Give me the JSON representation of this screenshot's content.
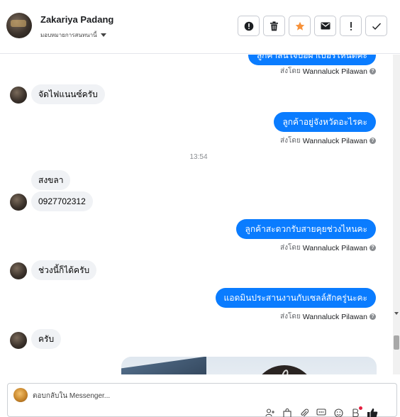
{
  "header": {
    "contact_name": "Zakariya Padang",
    "subtitle": "มอบหมายการสนทนานี้"
  },
  "actions": [
    {
      "name": "spam",
      "icon": "alert-circle-icon"
    },
    {
      "name": "delete",
      "icon": "trash-icon"
    },
    {
      "name": "star",
      "icon": "star-icon",
      "color": "#f7923a"
    },
    {
      "name": "mail",
      "icon": "envelope-icon"
    },
    {
      "name": "important",
      "icon": "exclamation-icon"
    },
    {
      "name": "done",
      "icon": "checkmark-icon"
    }
  ],
  "messages": {
    "m0": {
      "text": "ลูกค้าสนใจบ้อผ้าเบอร์ไหนดีคะ"
    },
    "m0_sender": "ส่งโดย",
    "m0_name": "Wannaluck Pilawan",
    "m1": {
      "text": "จัดไฟแนนซ์ครับ"
    },
    "m2": {
      "text": "ลูกค้าอยู่จังหวัดอะไรคะ"
    },
    "m2_sender": "ส่งโดย",
    "m2_name": "Wannaluck Pilawan",
    "time": "13:54",
    "m3": {
      "text": "สงขลา"
    },
    "m4": {
      "text": "0927702312"
    },
    "m5": {
      "text": "ลูกค้าสะดวกรับสายคุยช่วงไหนคะ"
    },
    "m5_sender": "ส่งโดย",
    "m5_name": "Wannaluck Pilawan",
    "m6": {
      "text": "ช่วงนี้ก็ได้ครับ"
    },
    "m7": {
      "text": "แอดมินประสานงานกับเซลล์สักครู่นะคะ"
    },
    "m7_sender": "ส่งโดย",
    "m7_name": "Wannaluck Pilawan",
    "m8": {
      "text": "ครับ"
    }
  },
  "reply": {
    "placeholder": "ตอบกลับใน Messenger..."
  },
  "colors": {
    "outgoing": "#0a7cff",
    "incoming": "#f0f2f5",
    "star": "#f7923a"
  }
}
